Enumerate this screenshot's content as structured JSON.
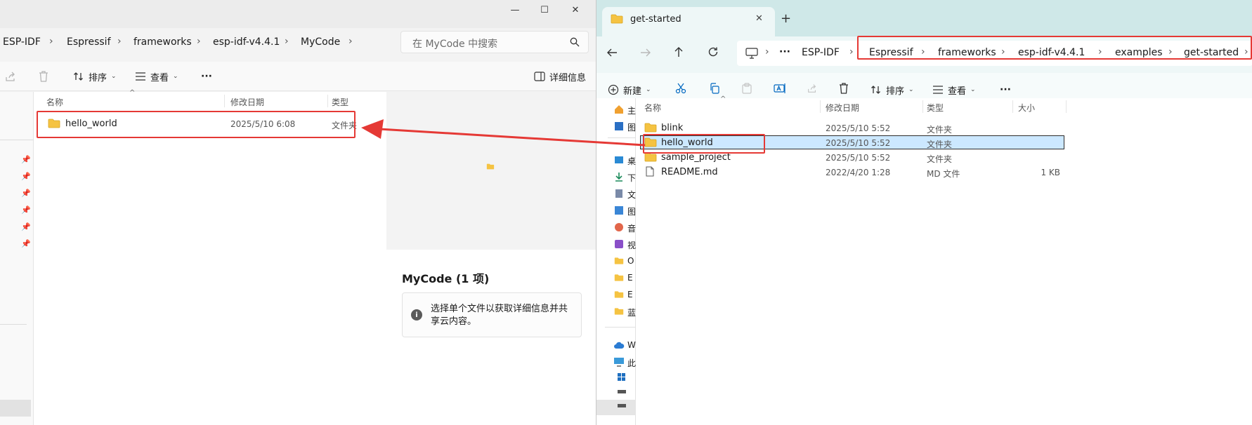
{
  "left_window": {
    "window_controls": {
      "minimize": "—",
      "maximize": "☐",
      "close": "✕"
    },
    "breadcrumbs": [
      "ESP-IDF",
      "Espressif",
      "frameworks",
      "esp-idf-v4.4.1",
      "MyCode"
    ],
    "search_placeholder": "在 MyCode 中搜索",
    "toolbar": {
      "sort_label": "排序",
      "view_label": "查看",
      "more_label": "···",
      "details_label": "详细信息"
    },
    "columns": {
      "name": "名称",
      "modified": "修改日期",
      "type": "类型"
    },
    "files": [
      {
        "name": "hello_world",
        "modified": "2025/5/10 6:08",
        "type": "文件夹"
      }
    ],
    "preview": {
      "title": "MyCode (1 项)",
      "info_message": "选择单个文件以获取详细信息并共享云内容。"
    }
  },
  "right_window": {
    "tab_title": "get-started",
    "new_tab_label": "+",
    "breadcrumbs_lead": "ESP-IDF",
    "breadcrumbs": [
      "Espressif",
      "frameworks",
      "esp-idf-v4.4.1",
      "examples",
      "get-started"
    ],
    "toolbar": {
      "new_label": "新建",
      "sort_label": "排序",
      "view_label": "查看",
      "more_label": "···"
    },
    "columns": {
      "name": "名称",
      "modified": "修改日期",
      "type": "类型",
      "size": "大小"
    },
    "files": [
      {
        "name": "blink",
        "modified": "2025/5/10 5:52",
        "type": "文件夹",
        "size": "",
        "icon": "folder-icon"
      },
      {
        "name": "hello_world",
        "modified": "2025/5/10 5:52",
        "type": "文件夹",
        "size": "",
        "icon": "folder-icon",
        "selected": true
      },
      {
        "name": "sample_project",
        "modified": "2025/5/10 5:52",
        "type": "文件夹",
        "size": "",
        "icon": "folder-icon"
      },
      {
        "name": "README.md",
        "modified": "2022/4/20 1:28",
        "type": "MD 文件",
        "size": "1 KB",
        "icon": "document-icon"
      }
    ],
    "nav_items": [
      "主",
      "图",
      "桌",
      "下",
      "文",
      "图",
      "音",
      "视",
      "O",
      "E",
      "E",
      "蓝",
      "W",
      "此"
    ]
  },
  "colors": {
    "accent_red": "#e53935",
    "folder_yellow": "#f5c342",
    "selection_blue": "#cce8ff",
    "tab_bar_teal": "#cfe8e8"
  }
}
